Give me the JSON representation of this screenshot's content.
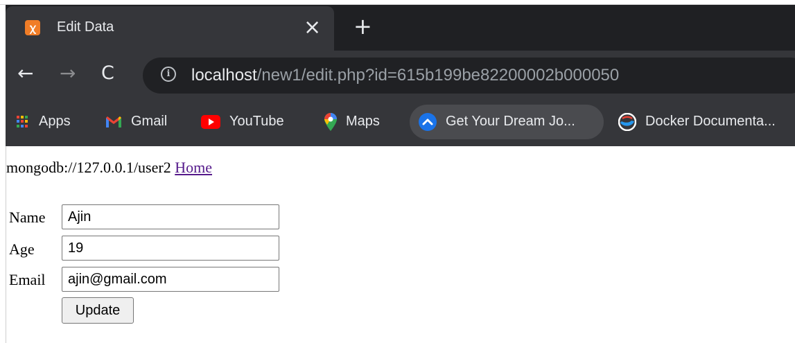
{
  "tab": {
    "title": "Edit Data",
    "close_glyph": "×",
    "new_tab_glyph": "+",
    "favicon": "xampp-icon"
  },
  "toolbar": {
    "back_glyph": "←",
    "forward_glyph": "→",
    "reload_glyph": "C",
    "info_glyph": "i",
    "url_host": "localhost",
    "url_path": "/new1/edit.php?id=615b199be82200002b000050"
  },
  "bookmarks": [
    {
      "label": "Apps",
      "icon": "apps-grid-icon"
    },
    {
      "label": "Gmail",
      "icon": "gmail-icon"
    },
    {
      "label": "YouTube",
      "icon": "youtube-icon"
    },
    {
      "label": "Maps",
      "icon": "maps-pin-icon"
    },
    {
      "label": "Get Your Dream Jo...",
      "icon": "chevron-up-circle-icon"
    },
    {
      "label": "Docker Documenta...",
      "icon": "docker-icon"
    }
  ],
  "page": {
    "connection_text": "mongodb://127.0.0.1/user2",
    "home_link": "Home",
    "form": {
      "name_label": "Name",
      "name_value": "Ajin",
      "age_label": "Age",
      "age_value": "19",
      "email_label": "Email",
      "email_value": "ajin@gmail.com",
      "submit_label": "Update"
    }
  },
  "colors": {
    "tabstrip": "#1f2023",
    "toolbar": "#35363a",
    "omnibox": "#202124",
    "link_visited": "#551a8b",
    "xampp_orange": "#f07d27"
  }
}
